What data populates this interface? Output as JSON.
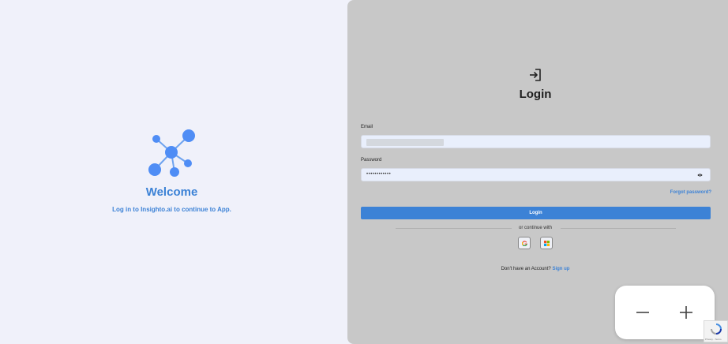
{
  "left": {
    "title": "Welcome",
    "subtitle": "Log in to Insighto.ai to continue to App.",
    "logo_icon": "network-nodes-icon"
  },
  "login": {
    "icon": "login-arrow-icon",
    "title": "Login",
    "email_label": "Email",
    "email_value": "",
    "password_label": "Password",
    "password_value": "••••••••••••",
    "forgot_label": "Forgot password?",
    "submit_label": "Login",
    "divider_text": "or continue with",
    "social": [
      "google-icon",
      "microsoft-icon"
    ],
    "no_account_text": "Don't have an Account?",
    "signup_label": "Sign up"
  },
  "zoom": {
    "minus_icon": "minus-icon",
    "plus_icon": "plus-icon"
  },
  "recaptcha": {
    "terms_text": "Privacy - Terms"
  },
  "colors": {
    "accent": "#3c82d6",
    "left_bg": "#f0f1fa",
    "right_bg": "#c8c8c8",
    "logo": "#4f8df5"
  }
}
